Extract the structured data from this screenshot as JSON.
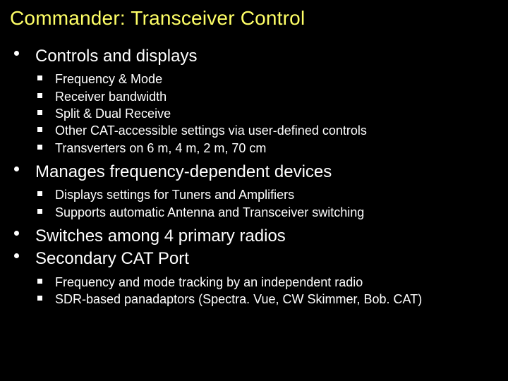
{
  "title": "Commander: Transceiver Control",
  "bullets": [
    {
      "text": "Controls and displays",
      "sub": [
        "Frequency & Mode",
        "Receiver bandwidth",
        "Split & Dual Receive",
        "Other CAT-accessible settings  via user-defined controls",
        "Transverters on 6 m, 4 m, 2 m, 70 cm"
      ]
    },
    {
      "text": "Manages frequency-dependent devices",
      "sub": [
        "Displays settings for Tuners and Amplifiers",
        "Supports automatic Antenna and Transceiver switching"
      ]
    },
    {
      "text": "Switches among 4 primary radios",
      "sub": []
    },
    {
      "text": "Secondary CAT Port",
      "sub": [
        "Frequency and mode tracking by an independent radio",
        "SDR-based panadaptors (Spectra. Vue, CW Skimmer, Bob. CAT)"
      ]
    }
  ]
}
